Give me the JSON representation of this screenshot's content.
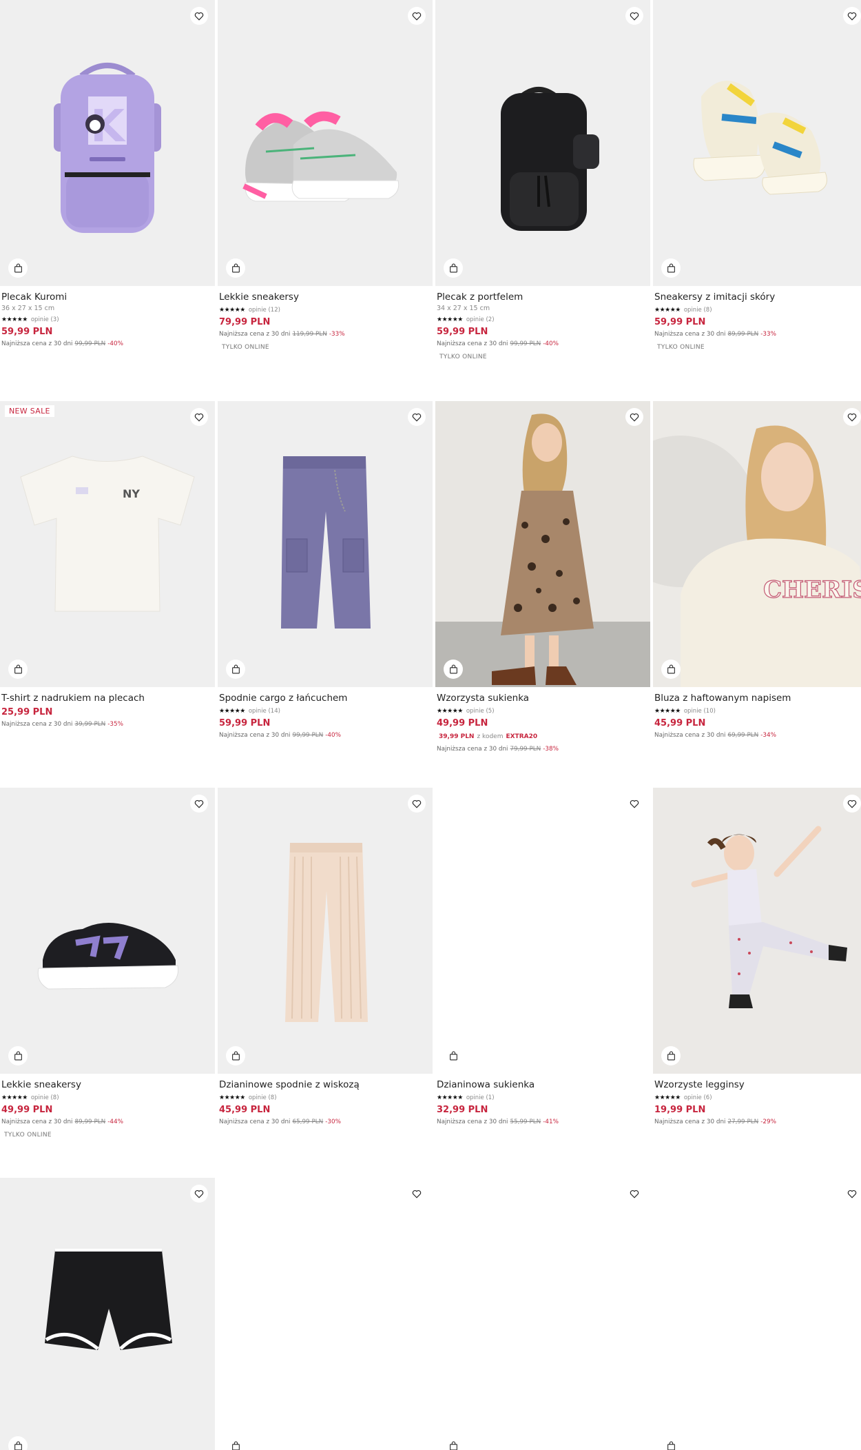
{
  "products": [
    {
      "name": "Plecak Kuromi",
      "dims": "36 x 27 x 15 cm",
      "opinions": "opinie (3)",
      "price": "59,99 PLN",
      "lowest_label": "Najniższa cena z 30 dni",
      "old_price": "99,99 PLN",
      "discount": "-40%",
      "online": ""
    },
    {
      "name": "Lekkie sneakersy",
      "dims": "",
      "opinions": "opinie (12)",
      "price": "79,99 PLN",
      "lowest_label": "Najniższa cena z 30 dni",
      "old_price": "119,99 PLN",
      "discount": "-33%",
      "online": "TYLKO ONLINE"
    },
    {
      "name": "Plecak z portfelem",
      "dims": "34 x 27 x 15 cm",
      "opinions": "opinie (2)",
      "price": "59,99 PLN",
      "lowest_label": "Najniższa cena z 30 dni",
      "old_price": "99,99 PLN",
      "discount": "-40%",
      "online": "TYLKO ONLINE"
    },
    {
      "name": "Sneakersy z imitacji skóry",
      "dims": "",
      "opinions": "opinie (8)",
      "price": "59,99 PLN",
      "lowest_label": "Najniższa cena z 30 dni",
      "old_price": "89,99 PLN",
      "discount": "-33%",
      "online": "TYLKO ONLINE"
    },
    {
      "name": "T-shirt z nadrukiem na plecach",
      "badge": "NEW SALE",
      "price": "25,99 PLN",
      "lowest_label": "Najniższa cena z 30 dni",
      "old_price": "39,99 PLN",
      "discount": "-35%"
    },
    {
      "name": "Spodnie cargo z łańcuchem",
      "opinions": "opinie (14)",
      "price": "59,99 PLN",
      "lowest_label": "Najniższa cena z 30 dni",
      "old_price": "99,99 PLN",
      "discount": "-40%"
    },
    {
      "name": "Wzorzysta sukienka",
      "opinions": "opinie (5)",
      "price": "49,99 PLN",
      "code_price": "39,99 PLN",
      "code_label": "z kodem",
      "code": "EXTRA20",
      "lowest_label": "Najniższa cena z 30 dni",
      "old_price": "79,99 PLN",
      "discount": "-38%"
    },
    {
      "name": "Bluza z haftowanym napisem",
      "opinions": "opinie (10)",
      "price": "45,99 PLN",
      "lowest_label": "Najniższa cena z 30 dni",
      "old_price": "69,99 PLN",
      "discount": "-34%",
      "print_text": "CHERISH"
    },
    {
      "name": "Lekkie sneakersy",
      "opinions": "opinie (8)",
      "price": "49,99 PLN",
      "lowest_label": "Najniższa cena z 30 dni",
      "old_price": "89,99 PLN",
      "discount": "-44%",
      "online": "TYLKO ONLINE"
    },
    {
      "name": "Dzianinowe spodnie z wiskozą",
      "opinions": "opinie (8)",
      "price": "45,99 PLN",
      "lowest_label": "Najniższa cena z 30 dni",
      "old_price": "65,99 PLN",
      "discount": "-30%"
    },
    {
      "name": "Dzianinowa sukienka",
      "opinions": "opinie (1)",
      "price": "32,99 PLN",
      "lowest_label": "Najniższa cena z 30 dni",
      "old_price": "55,99 PLN",
      "discount": "-41%"
    },
    {
      "name": "Wzorzyste legginsy",
      "opinions": "opinie (6)",
      "price": "19,99 PLN",
      "lowest_label": "Najniższa cena z 30 dni",
      "old_price": "27,99 PLN",
      "discount": "-29%"
    }
  ],
  "stars": "★★★★★",
  "icons": {
    "favorite": "heart-icon",
    "bag": "shopping-bag-icon"
  },
  "colors": {
    "accent": "#c7253e",
    "tile_bg": "#efefef"
  }
}
